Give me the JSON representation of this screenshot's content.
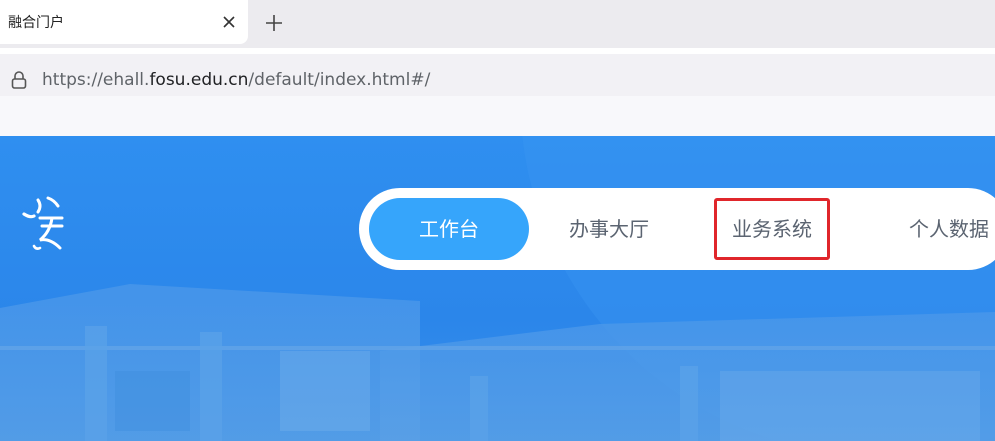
{
  "browser": {
    "tab_title": "融合门户",
    "url_prefix": "https://ehall.",
    "url_domain": "fosu.edu.cn",
    "url_path": "/default/index.html#/"
  },
  "portal": {
    "nav": {
      "workbench": "工作台",
      "service_hall": "办事大厅",
      "business_systems": "业务系统",
      "personal_data": "个人数据"
    },
    "colors": {
      "hero_blue": "#2f8ff0",
      "active_tab": "#36a5fb",
      "highlight_box": "#e0262b"
    }
  }
}
